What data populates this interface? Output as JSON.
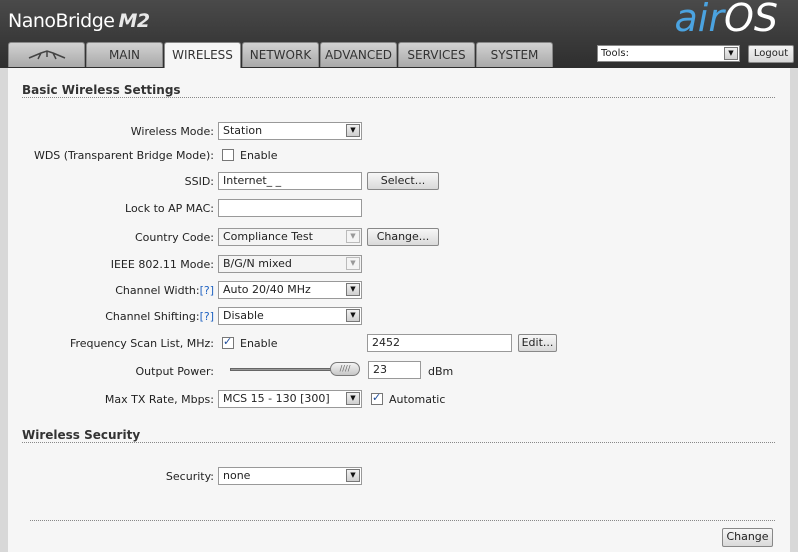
{
  "brand": {
    "name": "NanoBridge",
    "model": "M2",
    "os_prefix": "air",
    "os_suffix": "OS",
    "tm": "™"
  },
  "tabs": [
    {
      "label": ""
    },
    {
      "label": "MAIN"
    },
    {
      "label": "WIRELESS"
    },
    {
      "label": "NETWORK"
    },
    {
      "label": "ADVANCED"
    },
    {
      "label": "SERVICES"
    },
    {
      "label": "SYSTEM"
    }
  ],
  "tools": {
    "label": "Tools:"
  },
  "logout_label": "Logout",
  "basic": {
    "title": "Basic Wireless Settings",
    "wireless_mode": {
      "label": "Wireless Mode:",
      "value": "Station"
    },
    "wds": {
      "label": "WDS (Transparent Bridge Mode):",
      "option": "Enable",
      "checked": false
    },
    "ssid": {
      "label": "SSID:",
      "value": "Internet_   _",
      "button": "Select..."
    },
    "lock_ap": {
      "label": "Lock to AP MAC:",
      "value": ""
    },
    "country": {
      "label": "Country Code:",
      "value": "Compliance Test",
      "button": "Change..."
    },
    "ieee": {
      "label": "IEEE 802.11 Mode:",
      "value": "B/G/N mixed"
    },
    "channel_width": {
      "label": "Channel Width:",
      "help": "[?]",
      "value": "Auto 20/40 MHz"
    },
    "channel_shifting": {
      "label": "Channel Shifting:",
      "help": "[?]",
      "value": "Disable"
    },
    "freq_scan": {
      "label": "Frequency Scan List, MHz:",
      "option": "Enable",
      "checked": true,
      "value": "2452",
      "button": "Edit..."
    },
    "output_power": {
      "label": "Output Power:",
      "value": "23",
      "unit": "dBm",
      "slider_level": 1.0
    },
    "max_tx": {
      "label": "Max TX Rate, Mbps:",
      "value": "MCS 15 - 130 [300]",
      "option": "Automatic",
      "checked": true
    }
  },
  "security": {
    "title": "Wireless Security",
    "security": {
      "label": "Security:",
      "value": "none"
    }
  },
  "change_label": "Change"
}
